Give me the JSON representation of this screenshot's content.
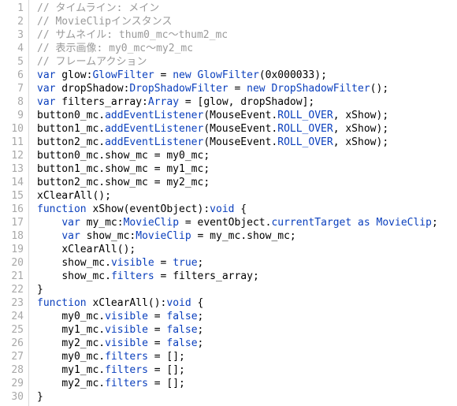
{
  "code": {
    "lines": [
      {
        "n": 1,
        "tokens": [
          {
            "t": "// タイムライン: メイン",
            "c": "comment"
          }
        ]
      },
      {
        "n": 2,
        "tokens": [
          {
            "t": "// MovieClipインスタンス",
            "c": "comment"
          }
        ]
      },
      {
        "n": 3,
        "tokens": [
          {
            "t": "// サムネイル: thum0_mc～thum2_mc",
            "c": "comment"
          }
        ]
      },
      {
        "n": 4,
        "tokens": [
          {
            "t": "// 表示画像: my0_mc～my2_mc",
            "c": "comment"
          }
        ]
      },
      {
        "n": 5,
        "tokens": [
          {
            "t": "// フレームアクション",
            "c": "comment"
          }
        ]
      },
      {
        "n": 6,
        "tokens": [
          {
            "t": "var",
            "c": "keyword"
          },
          {
            "t": " glow:",
            "c": "ident"
          },
          {
            "t": "GlowFilter",
            "c": "type"
          },
          {
            "t": " = ",
            "c": "punct"
          },
          {
            "t": "new",
            "c": "keyword"
          },
          {
            "t": " ",
            "c": "punct"
          },
          {
            "t": "GlowFilter",
            "c": "type"
          },
          {
            "t": "(0x000033);",
            "c": "punct"
          }
        ]
      },
      {
        "n": 7,
        "tokens": [
          {
            "t": "var",
            "c": "keyword"
          },
          {
            "t": " dropShadow:",
            "c": "ident"
          },
          {
            "t": "DropShadowFilter",
            "c": "type"
          },
          {
            "t": " = ",
            "c": "punct"
          },
          {
            "t": "new",
            "c": "keyword"
          },
          {
            "t": " ",
            "c": "punct"
          },
          {
            "t": "DropShadowFilter",
            "c": "type"
          },
          {
            "t": "();",
            "c": "punct"
          }
        ]
      },
      {
        "n": 8,
        "tokens": [
          {
            "t": "var",
            "c": "keyword"
          },
          {
            "t": " filters_array:",
            "c": "ident"
          },
          {
            "t": "Array",
            "c": "type"
          },
          {
            "t": " = [glow, dropShadow];",
            "c": "punct"
          }
        ]
      },
      {
        "n": 9,
        "tokens": [
          {
            "t": "button0_mc.",
            "c": "ident"
          },
          {
            "t": "addEventListener",
            "c": "member"
          },
          {
            "t": "(MouseEvent.",
            "c": "ident"
          },
          {
            "t": "ROLL_OVER",
            "c": "enum"
          },
          {
            "t": ", xShow);",
            "c": "punct"
          }
        ]
      },
      {
        "n": 10,
        "tokens": [
          {
            "t": "button1_mc.",
            "c": "ident"
          },
          {
            "t": "addEventListener",
            "c": "member"
          },
          {
            "t": "(MouseEvent.",
            "c": "ident"
          },
          {
            "t": "ROLL_OVER",
            "c": "enum"
          },
          {
            "t": ", xShow);",
            "c": "punct"
          }
        ]
      },
      {
        "n": 11,
        "tokens": [
          {
            "t": "button2_mc.",
            "c": "ident"
          },
          {
            "t": "addEventListener",
            "c": "member"
          },
          {
            "t": "(MouseEvent.",
            "c": "ident"
          },
          {
            "t": "ROLL_OVER",
            "c": "enum"
          },
          {
            "t": ", xShow);",
            "c": "punct"
          }
        ]
      },
      {
        "n": 12,
        "tokens": [
          {
            "t": "button0_mc.show_mc = my0_mc;",
            "c": "ident"
          }
        ]
      },
      {
        "n": 13,
        "tokens": [
          {
            "t": "button1_mc.show_mc = my1_mc;",
            "c": "ident"
          }
        ]
      },
      {
        "n": 14,
        "tokens": [
          {
            "t": "button2_mc.show_mc = my2_mc;",
            "c": "ident"
          }
        ]
      },
      {
        "n": 15,
        "tokens": [
          {
            "t": "xClearAll();",
            "c": "ident"
          }
        ]
      },
      {
        "n": 16,
        "tokens": [
          {
            "t": "function",
            "c": "keyword"
          },
          {
            "t": " xShow(eventObject):",
            "c": "ident"
          },
          {
            "t": "void",
            "c": "type"
          },
          {
            "t": " {",
            "c": "punct"
          }
        ]
      },
      {
        "n": 17,
        "indent": 1,
        "tokens": [
          {
            "t": "var",
            "c": "keyword"
          },
          {
            "t": " my_mc:",
            "c": "ident"
          },
          {
            "t": "MovieClip",
            "c": "type"
          },
          {
            "t": " = eventObject.",
            "c": "ident"
          },
          {
            "t": "currentTarget",
            "c": "member"
          },
          {
            "t": " ",
            "c": "punct"
          },
          {
            "t": "as",
            "c": "keyword"
          },
          {
            "t": " ",
            "c": "punct"
          },
          {
            "t": "MovieClip",
            "c": "type"
          },
          {
            "t": ";",
            "c": "punct"
          }
        ]
      },
      {
        "n": 18,
        "indent": 1,
        "tokens": [
          {
            "t": "var",
            "c": "keyword"
          },
          {
            "t": " show_mc:",
            "c": "ident"
          },
          {
            "t": "MovieClip",
            "c": "type"
          },
          {
            "t": " = my_mc.show_mc;",
            "c": "ident"
          }
        ]
      },
      {
        "n": 19,
        "indent": 1,
        "tokens": [
          {
            "t": "xClearAll();",
            "c": "ident"
          }
        ]
      },
      {
        "n": 20,
        "indent": 1,
        "tokens": [
          {
            "t": "show_mc.",
            "c": "ident"
          },
          {
            "t": "visible",
            "c": "member"
          },
          {
            "t": " = ",
            "c": "punct"
          },
          {
            "t": "true",
            "c": "literal"
          },
          {
            "t": ";",
            "c": "punct"
          }
        ]
      },
      {
        "n": 21,
        "indent": 1,
        "tokens": [
          {
            "t": "show_mc.",
            "c": "ident"
          },
          {
            "t": "filters",
            "c": "member"
          },
          {
            "t": " = filters_array;",
            "c": "ident"
          }
        ]
      },
      {
        "n": 22,
        "tokens": [
          {
            "t": "}",
            "c": "punct"
          }
        ]
      },
      {
        "n": 23,
        "tokens": [
          {
            "t": "function",
            "c": "keyword"
          },
          {
            "t": " xClearAll():",
            "c": "ident"
          },
          {
            "t": "void",
            "c": "type"
          },
          {
            "t": " {",
            "c": "punct"
          }
        ]
      },
      {
        "n": 24,
        "indent": 1,
        "tokens": [
          {
            "t": "my0_mc.",
            "c": "ident"
          },
          {
            "t": "visible",
            "c": "member"
          },
          {
            "t": " = ",
            "c": "punct"
          },
          {
            "t": "false",
            "c": "literal"
          },
          {
            "t": ";",
            "c": "punct"
          }
        ]
      },
      {
        "n": 25,
        "indent": 1,
        "tokens": [
          {
            "t": "my1_mc.",
            "c": "ident"
          },
          {
            "t": "visible",
            "c": "member"
          },
          {
            "t": " = ",
            "c": "punct"
          },
          {
            "t": "false",
            "c": "literal"
          },
          {
            "t": ";",
            "c": "punct"
          }
        ]
      },
      {
        "n": 26,
        "indent": 1,
        "tokens": [
          {
            "t": "my2_mc.",
            "c": "ident"
          },
          {
            "t": "visible",
            "c": "member"
          },
          {
            "t": " = ",
            "c": "punct"
          },
          {
            "t": "false",
            "c": "literal"
          },
          {
            "t": ";",
            "c": "punct"
          }
        ]
      },
      {
        "n": 27,
        "indent": 1,
        "tokens": [
          {
            "t": "my0_mc.",
            "c": "ident"
          },
          {
            "t": "filters",
            "c": "member"
          },
          {
            "t": " = [];",
            "c": "punct"
          }
        ]
      },
      {
        "n": 28,
        "indent": 1,
        "tokens": [
          {
            "t": "my1_mc.",
            "c": "ident"
          },
          {
            "t": "filters",
            "c": "member"
          },
          {
            "t": " = [];",
            "c": "punct"
          }
        ]
      },
      {
        "n": 29,
        "indent": 1,
        "tokens": [
          {
            "t": "my2_mc.",
            "c": "ident"
          },
          {
            "t": "filters",
            "c": "member"
          },
          {
            "t": " = [];",
            "c": "punct"
          }
        ]
      },
      {
        "n": 30,
        "tokens": [
          {
            "t": "}",
            "c": "punct"
          }
        ]
      }
    ]
  }
}
